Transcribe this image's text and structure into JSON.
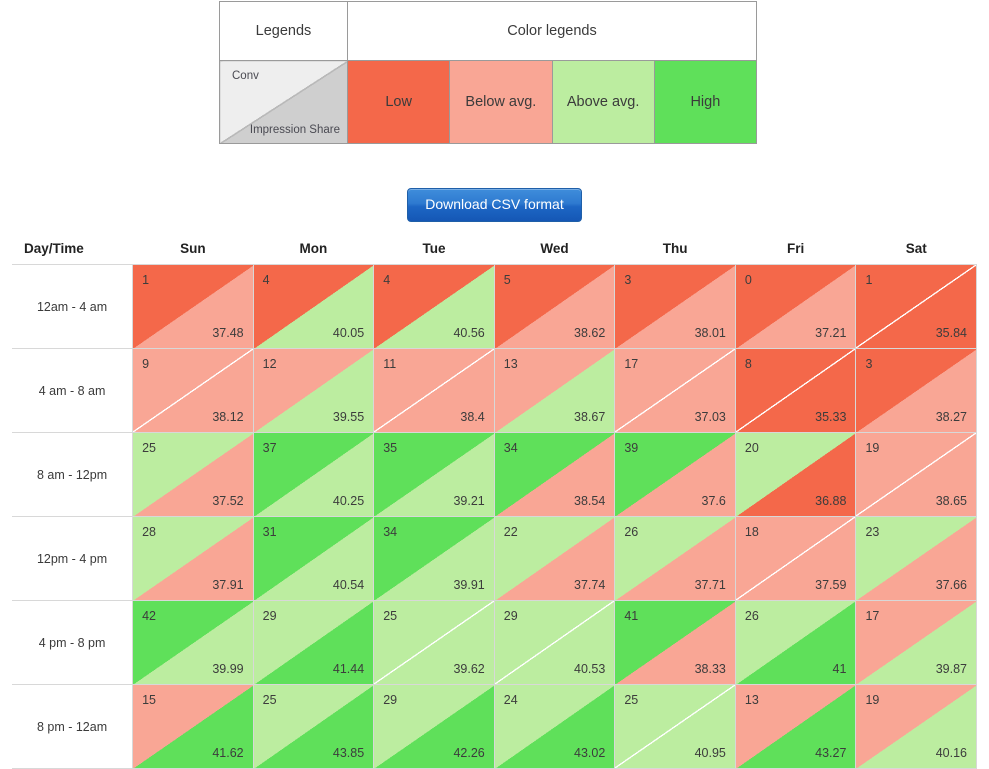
{
  "legend": {
    "header_legends": "Legends",
    "header_color_legends": "Color legends",
    "split_cell": {
      "top_label": "Conv",
      "bottom_label": "Impression Share"
    },
    "swatches": [
      {
        "label": "Low",
        "color": "#F4684A"
      },
      {
        "label": "Below avg.",
        "color": "#F9A695"
      },
      {
        "label": "Above avg.",
        "color": "#BCEDA0"
      },
      {
        "label": "High",
        "color": "#5FE05A"
      }
    ]
  },
  "actions": {
    "download_csv": "Download CSV format"
  },
  "heatmap": {
    "columns": [
      "Day/Time",
      "Sun",
      "Mon",
      "Tue",
      "Wed",
      "Thu",
      "Fri",
      "Sat"
    ],
    "rows": [
      {
        "label": "12am - 4 am",
        "cells": [
          {
            "conv": "1",
            "conv_level": "low",
            "is": "37.48",
            "is_level": "below_avg"
          },
          {
            "conv": "4",
            "conv_level": "low",
            "is": "40.05",
            "is_level": "above_avg"
          },
          {
            "conv": "4",
            "conv_level": "low",
            "is": "40.56",
            "is_level": "above_avg"
          },
          {
            "conv": "5",
            "conv_level": "low",
            "is": "38.62",
            "is_level": "below_avg"
          },
          {
            "conv": "3",
            "conv_level": "low",
            "is": "38.01",
            "is_level": "below_avg"
          },
          {
            "conv": "0",
            "conv_level": "low",
            "is": "37.21",
            "is_level": "below_avg"
          },
          {
            "conv": "1",
            "conv_level": "low",
            "is": "35.84",
            "is_level": "low"
          }
        ]
      },
      {
        "label": "4 am - 8 am",
        "cells": [
          {
            "conv": "9",
            "conv_level": "below_avg",
            "is": "38.12",
            "is_level": "below_avg"
          },
          {
            "conv": "12",
            "conv_level": "below_avg",
            "is": "39.55",
            "is_level": "above_avg"
          },
          {
            "conv": "11",
            "conv_level": "below_avg",
            "is": "38.4",
            "is_level": "below_avg"
          },
          {
            "conv": "13",
            "conv_level": "below_avg",
            "is": "38.67",
            "is_level": "above_avg"
          },
          {
            "conv": "17",
            "conv_level": "below_avg",
            "is": "37.03",
            "is_level": "below_avg"
          },
          {
            "conv": "8",
            "conv_level": "low",
            "is": "35.33",
            "is_level": "low"
          },
          {
            "conv": "3",
            "conv_level": "low",
            "is": "38.27",
            "is_level": "below_avg"
          }
        ]
      },
      {
        "label": "8 am - 12pm",
        "cells": [
          {
            "conv": "25",
            "conv_level": "above_avg",
            "is": "37.52",
            "is_level": "below_avg"
          },
          {
            "conv": "37",
            "conv_level": "high",
            "is": "40.25",
            "is_level": "above_avg"
          },
          {
            "conv": "35",
            "conv_level": "high",
            "is": "39.21",
            "is_level": "above_avg"
          },
          {
            "conv": "34",
            "conv_level": "high",
            "is": "38.54",
            "is_level": "below_avg"
          },
          {
            "conv": "39",
            "conv_level": "high",
            "is": "37.6",
            "is_level": "below_avg"
          },
          {
            "conv": "20",
            "conv_level": "above_avg",
            "is": "36.88",
            "is_level": "low"
          },
          {
            "conv": "19",
            "conv_level": "below_avg",
            "is": "38.65",
            "is_level": "below_avg"
          }
        ]
      },
      {
        "label": "12pm - 4 pm",
        "cells": [
          {
            "conv": "28",
            "conv_level": "above_avg",
            "is": "37.91",
            "is_level": "below_avg"
          },
          {
            "conv": "31",
            "conv_level": "high",
            "is": "40.54",
            "is_level": "above_avg"
          },
          {
            "conv": "34",
            "conv_level": "high",
            "is": "39.91",
            "is_level": "above_avg"
          },
          {
            "conv": "22",
            "conv_level": "above_avg",
            "is": "37.74",
            "is_level": "below_avg"
          },
          {
            "conv": "26",
            "conv_level": "above_avg",
            "is": "37.71",
            "is_level": "below_avg"
          },
          {
            "conv": "18",
            "conv_level": "below_avg",
            "is": "37.59",
            "is_level": "below_avg"
          },
          {
            "conv": "23",
            "conv_level": "above_avg",
            "is": "37.66",
            "is_level": "below_avg"
          }
        ]
      },
      {
        "label": "4 pm - 8 pm",
        "cells": [
          {
            "conv": "42",
            "conv_level": "high",
            "is": "39.99",
            "is_level": "above_avg"
          },
          {
            "conv": "29",
            "conv_level": "above_avg",
            "is": "41.44",
            "is_level": "high"
          },
          {
            "conv": "25",
            "conv_level": "above_avg",
            "is": "39.62",
            "is_level": "above_avg"
          },
          {
            "conv": "29",
            "conv_level": "above_avg",
            "is": "40.53",
            "is_level": "above_avg"
          },
          {
            "conv": "41",
            "conv_level": "high",
            "is": "38.33",
            "is_level": "below_avg"
          },
          {
            "conv": "26",
            "conv_level": "above_avg",
            "is": "41",
            "is_level": "high"
          },
          {
            "conv": "17",
            "conv_level": "below_avg",
            "is": "39.87",
            "is_level": "above_avg"
          }
        ]
      },
      {
        "label": "8 pm - 12am",
        "cells": [
          {
            "conv": "15",
            "conv_level": "below_avg",
            "is": "41.62",
            "is_level": "high"
          },
          {
            "conv": "25",
            "conv_level": "above_avg",
            "is": "43.85",
            "is_level": "high"
          },
          {
            "conv": "29",
            "conv_level": "above_avg",
            "is": "42.26",
            "is_level": "high"
          },
          {
            "conv": "24",
            "conv_level": "above_avg",
            "is": "43.02",
            "is_level": "high"
          },
          {
            "conv": "25",
            "conv_level": "above_avg",
            "is": "40.95",
            "is_level": "above_avg"
          },
          {
            "conv": "13",
            "conv_level": "below_avg",
            "is": "43.27",
            "is_level": "high"
          },
          {
            "conv": "19",
            "conv_level": "below_avg",
            "is": "40.16",
            "is_level": "above_avg"
          }
        ]
      }
    ]
  },
  "palette": {
    "low": "#F4684A",
    "below_avg": "#F9A695",
    "above_avg": "#BCEDA0",
    "high": "#5FE05A"
  }
}
